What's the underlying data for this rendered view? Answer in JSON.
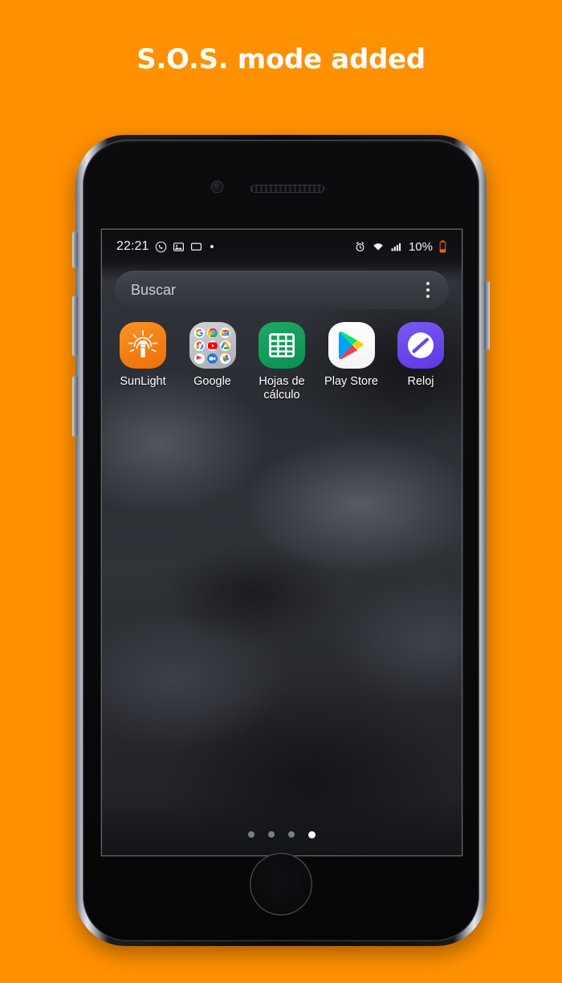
{
  "headline": "S.O.S. mode added",
  "theme": {
    "background": "#FF9000",
    "headline_color": "#FFFFFF",
    "battery_color": "#E8641A"
  },
  "phone": {
    "frame_label": "smartphone-mockup",
    "home_button_label": "Home",
    "camera_label": "Front camera",
    "speaker_label": "Earpiece speaker"
  },
  "screen": {
    "statusbar": {
      "clock": "22:21",
      "left_icons": [
        "whatsapp-icon",
        "gallery-icon",
        "screen-cast-icon",
        "dot-indicator"
      ],
      "right_icons": [
        "alarm-icon",
        "wifi-icon",
        "signal-icon"
      ],
      "battery_percent": "10%",
      "battery_icon": "battery-low-icon"
    },
    "search": {
      "placeholder": "Buscar",
      "menu_label": "more-options"
    },
    "apps": [
      {
        "label": "SunLight",
        "icon": "flashlight-icon"
      },
      {
        "label": "Google",
        "icon": "google-folder-icon"
      },
      {
        "label": "Hojas de cálculo",
        "icon": "google-sheets-icon"
      },
      {
        "label": "Play Store",
        "icon": "play-store-icon"
      },
      {
        "label": "Reloj",
        "icon": "clock-icon"
      }
    ],
    "folder_apps": [
      "Google",
      "Chrome",
      "Gmail",
      "Maps",
      "YouTube",
      "Drive",
      "Play",
      "Meet",
      "Photos"
    ],
    "page_dots": {
      "count": 4,
      "active_index": 3
    }
  }
}
